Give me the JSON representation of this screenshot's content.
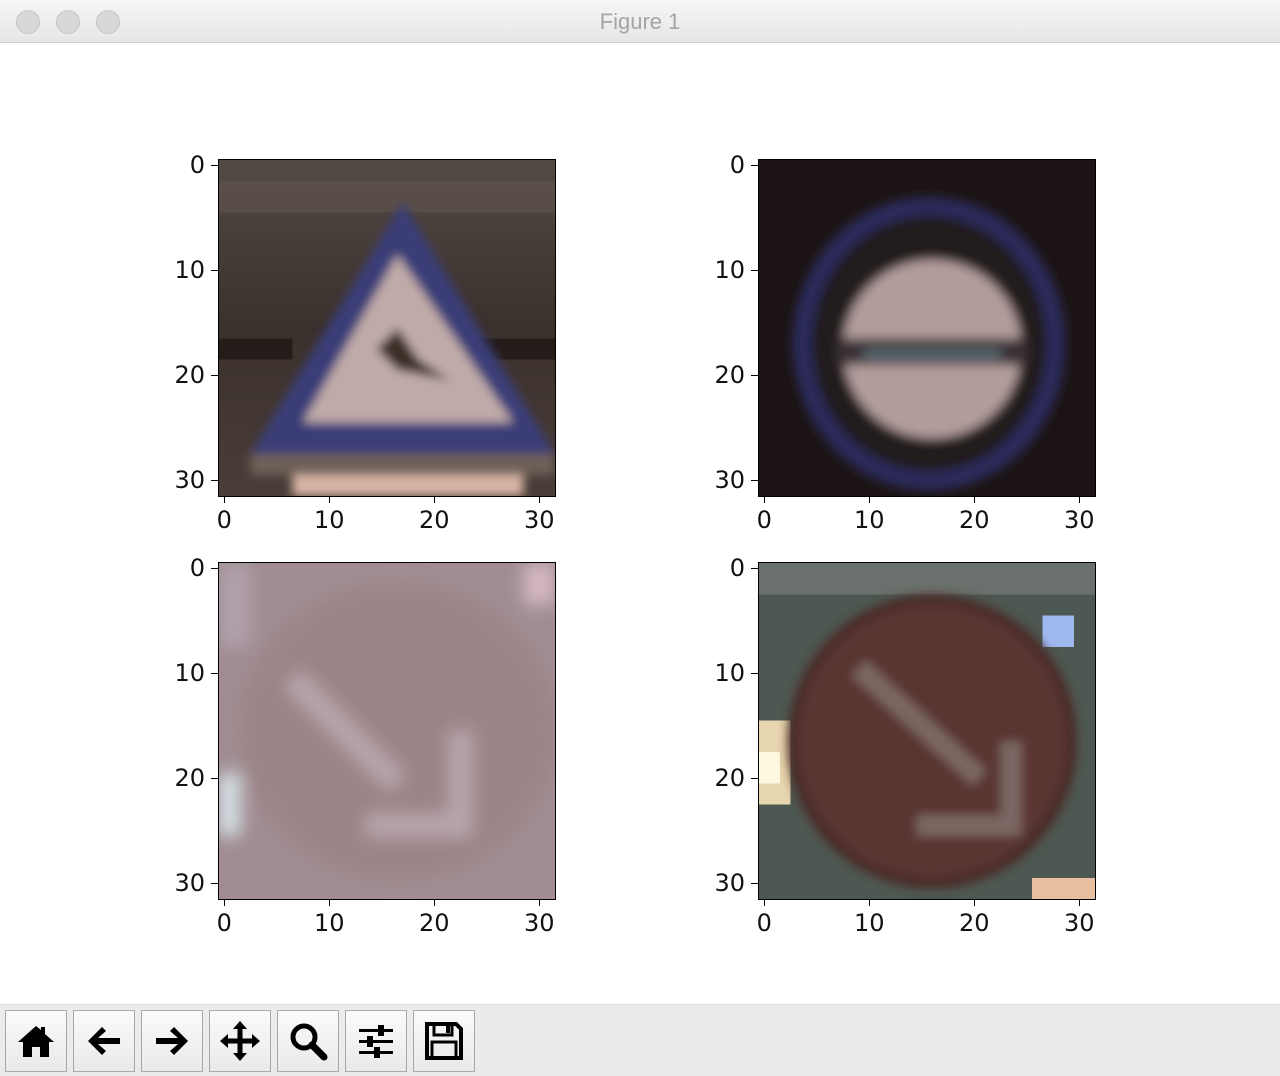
{
  "window": {
    "title": "Figure 1"
  },
  "toolbar": {
    "buttons": [
      {
        "name": "home-button",
        "icon": "home-icon"
      },
      {
        "name": "back-button",
        "icon": "arrow-left-icon"
      },
      {
        "name": "forward-button",
        "icon": "arrow-right-icon"
      },
      {
        "name": "pan-button",
        "icon": "move-icon"
      },
      {
        "name": "zoom-button",
        "icon": "magnifier-icon"
      },
      {
        "name": "configure-subplots-button",
        "icon": "sliders-icon"
      },
      {
        "name": "save-button",
        "icon": "floppy-disk-icon"
      }
    ]
  },
  "figure": {
    "subplots": [
      {
        "content": "triangular warning sign (road narrows / curve)",
        "xticks": [
          "0",
          "10",
          "20",
          "30"
        ],
        "yticks": [
          "0",
          "10",
          "20",
          "30"
        ],
        "xlim": [
          -0.5,
          31.5
        ],
        "ylim": [
          31.5,
          -0.5
        ]
      },
      {
        "content": "round sign with blue border and white band",
        "xticks": [
          "0",
          "10",
          "20",
          "30"
        ],
        "yticks": [
          "0",
          "10",
          "20",
          "30"
        ],
        "xlim": [
          -0.5,
          31.5
        ],
        "ylim": [
          31.5,
          -0.5
        ]
      },
      {
        "content": "washed-out keep-right arrow sign",
        "xticks": [
          "0",
          "10",
          "20",
          "30"
        ],
        "yticks": [
          "0",
          "10",
          "20",
          "30"
        ],
        "xlim": [
          -0.5,
          31.5
        ],
        "ylim": [
          31.5,
          -0.5
        ]
      },
      {
        "content": "dark round keep-right arrow sign",
        "xticks": [
          "0",
          "10",
          "20",
          "30"
        ],
        "yticks": [
          "0",
          "10",
          "20",
          "30"
        ],
        "xlim": [
          -0.5,
          31.5
        ],
        "ylim": [
          31.5,
          -0.5
        ]
      }
    ]
  }
}
